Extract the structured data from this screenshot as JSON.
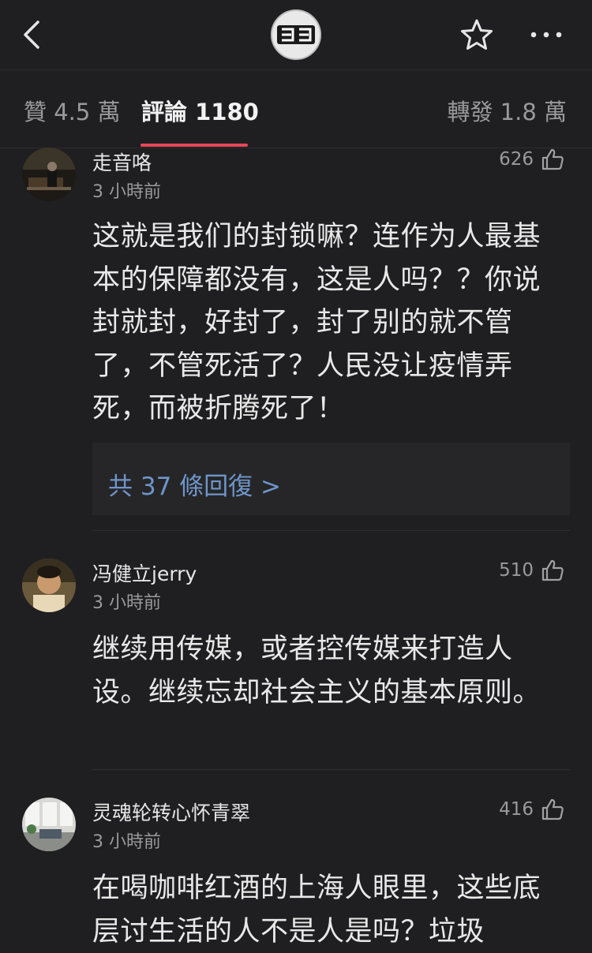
{
  "header": {
    "logo_text": "33",
    "icons": [
      "chevron-left-icon",
      "star-icon",
      "more-horizontal-icon"
    ]
  },
  "tabs": [
    {
      "label": "贊 4.5 萬",
      "active": false
    },
    {
      "label": "評論 1180",
      "active": true
    },
    {
      "label": "轉發 1.8 萬",
      "active": false
    }
  ],
  "colors": {
    "background": "#1f1f21",
    "tab_accent": "#e8475a",
    "link": "#6f95c9"
  },
  "comments": [
    {
      "username": "走音咯",
      "time": "3 小時前",
      "likes": "626",
      "text": "这就是我们的封锁嘛？连作为人最基本的保障都没有，这是人吗？？你说封就封，好封了，封了别的就不管了，不管死活了？人民没让疫情弄死，而被折腾死了！",
      "replies_label": "共 37 條回復 >"
    },
    {
      "username": "冯健立jerry",
      "time": "3 小時前",
      "likes": "510",
      "text": "继续用传媒，或者控传媒来打造人设。继续忘却社会主义的基本原则。"
    },
    {
      "username": "灵魂轮转心怀青翠",
      "time": "3 小時前",
      "likes": "416",
      "text": "在喝咖啡红酒的上海人眼里，这些底层讨生活的人不是人是吗？垃圾"
    }
  ]
}
